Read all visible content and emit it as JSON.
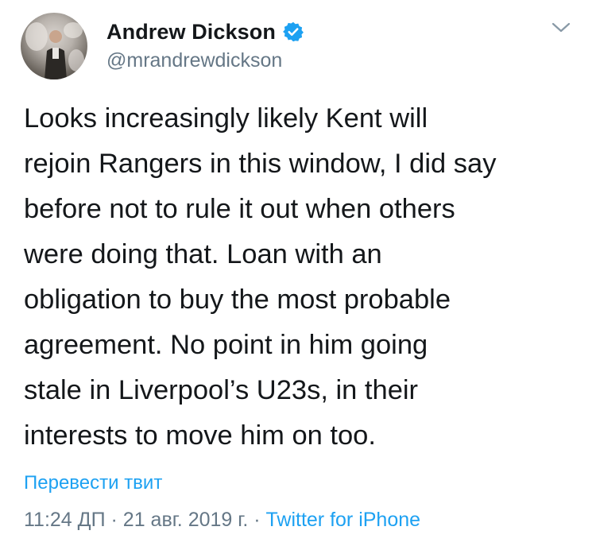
{
  "author": {
    "display_name": "Andrew Dickson",
    "handle": "@mrandrewdickson",
    "verified": true
  },
  "tweet": {
    "lines": [
      "Looks increasingly likely Kent will",
      "rejoin Rangers in this window, I did say",
      "before not to rule it out when others",
      "were doing that. Loan with an",
      "obligation to buy the most probable",
      "agreement. No point in him going",
      "stale in Liverpool’s U23s, in their",
      "interests to move him on too."
    ]
  },
  "translate_label": "Перевести твит",
  "meta": {
    "time": "11:24 ДП",
    "separator": "·",
    "date": "21 авг. 2019 г.",
    "source": "Twitter for iPhone"
  },
  "colors": {
    "accent": "#1da1f2",
    "text": "#14171a",
    "secondary": "#657786"
  },
  "icons": {
    "verified": "verified-badge-icon",
    "menu": "chevron-down-icon"
  }
}
